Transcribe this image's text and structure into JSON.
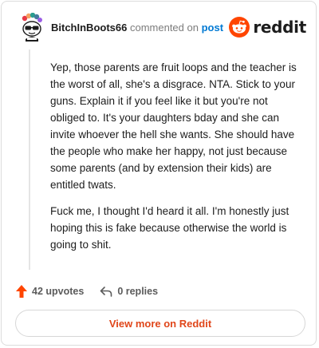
{
  "comment": {
    "author": "BitchInBoots66",
    "action_text": "commented on",
    "post_link": "post",
    "paragraphs": [
      "Yep, those parents are fruit loops and the teacher is the worst of all, she's a disgrace. NTA. Stick to your guns. Explain it if you feel like it but you're not obliged to. It's your daughters bday and she can invite whoever the hell she wants. She should have the people who make her happy, not just because some parents (and by extension their kids) are entitled twats.",
      "Fuck me, I thought I'd heard it all. I'm honestly just hoping this is fake because otherwise the world is going to shit."
    ],
    "upvotes": "42 upvotes",
    "replies": "0 replies"
  },
  "brand": {
    "wordmark": "reddit",
    "accent_color": "#ff4500",
    "upvote_color": "#ff4500",
    "link_color": "#0079d3",
    "cta_color": "#e0461a"
  },
  "icons": {
    "avatar": "snoo-avatar-icon",
    "logo": "reddit-snoo-icon",
    "upvote": "upvote-arrow-icon",
    "reply": "reply-arrow-icon"
  },
  "footer": {
    "view_more_label": "View more on Reddit"
  }
}
